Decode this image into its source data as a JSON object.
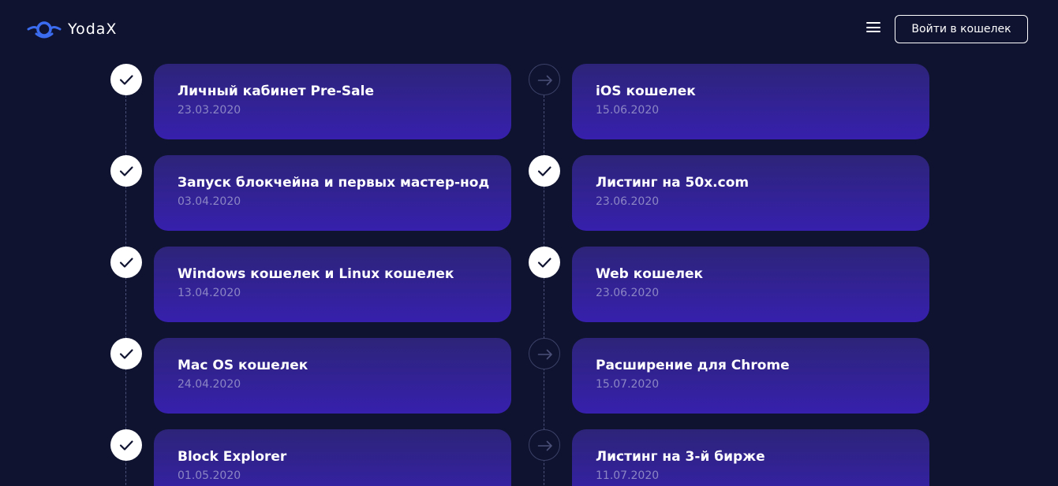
{
  "header": {
    "logo_text": "YodaX",
    "wallet_button": "Войти в кошелек",
    "menu_icon": "hamburger-icon",
    "colors": {
      "background": "#0f1330",
      "logo_accent": "#3b6cf0"
    }
  },
  "roadmap": {
    "colors": {
      "card_top": "#2d2479",
      "card_bottom": "#3620ad",
      "date_text": "#8c86c4",
      "done_marker": "#ffffff",
      "pending_marker": "#3c4268"
    },
    "left": [
      {
        "title": "Личный кабинет Pre-Sale",
        "date": "23.03.2020",
        "status": "done"
      },
      {
        "title": "Запуск блокчейна и первых мастер-нод",
        "date": "03.04.2020",
        "status": "done"
      },
      {
        "title": "Windows кошелек и Linux кошелек",
        "date": "13.04.2020",
        "status": "done"
      },
      {
        "title": "Mac OS кошелек",
        "date": "24.04.2020",
        "status": "done"
      },
      {
        "title": "Block Explorer",
        "date": "01.05.2020",
        "status": "done"
      }
    ],
    "right": [
      {
        "title": "iOS кошелек",
        "date": "15.06.2020",
        "status": "pending"
      },
      {
        "title": "Листинг на 50x.com",
        "date": "23.06.2020",
        "status": "done"
      },
      {
        "title": "Web кошелек",
        "date": "23.06.2020",
        "status": "done"
      },
      {
        "title": "Расширение для Chrome",
        "date": "15.07.2020",
        "status": "pending"
      },
      {
        "title": "Листинг на 3-й бирже",
        "date": "11.07.2020",
        "status": "pending"
      }
    ]
  }
}
